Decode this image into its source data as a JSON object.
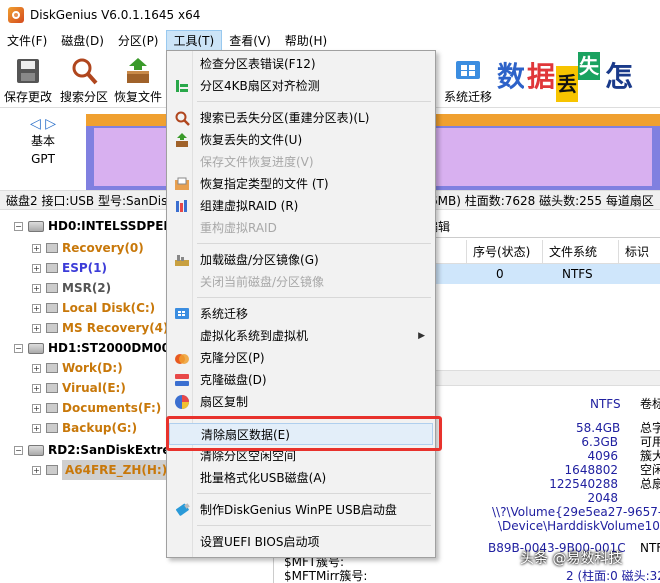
{
  "window": {
    "title": "DiskGenius V6.0.1.1645 x64"
  },
  "menubar": [
    "文件(F)",
    "磁盘(D)",
    "分区(P)",
    "工具(T)",
    "查看(V)",
    "帮助(H)"
  ],
  "toolbar": {
    "save": "保存更改",
    "search": "搜索分区",
    "recover": "恢复文件",
    "migrate": "系统迁移"
  },
  "ad": [
    "数",
    "据",
    "丢",
    "失",
    "怎"
  ],
  "nav": {
    "line1": "基本",
    "line2": "GPT"
  },
  "partition": {
    "name": "A64FRE_ZH(H:)",
    "fs": "NTFS",
    "size": "58.4GB"
  },
  "infoline": "磁盘2 接口:USB  型号:SanDisk",
  "infoline_right": "6MB)  柱面数:7628  磁头数:255  每道扇区",
  "tree": [
    {
      "label": "HD0:INTELSSDPEKK",
      "kind": "disk"
    },
    {
      "label": "Recovery(0)",
      "kind": "part",
      "color": "orange"
    },
    {
      "label": "ESP(1)",
      "kind": "part",
      "color": "blue"
    },
    {
      "label": "MSR(2)",
      "kind": "part",
      "color": "gray"
    },
    {
      "label": "Local Disk(C:)",
      "kind": "part",
      "color": "orange"
    },
    {
      "label": "MS Recovery(4)",
      "kind": "part",
      "color": "orange"
    },
    {
      "label": "HD1:ST2000DM008",
      "kind": "disk"
    },
    {
      "label": "Work(D:)",
      "kind": "part",
      "color": "orange"
    },
    {
      "label": "Virual(E:)",
      "kind": "part",
      "color": "orange"
    },
    {
      "label": "Documents(F:)",
      "kind": "part",
      "color": "orange"
    },
    {
      "label": "Backup(G:)",
      "kind": "part",
      "color": "orange"
    },
    {
      "label": "RD2:SanDiskExtrem",
      "kind": "disk"
    },
    {
      "label": "A64FRE_ZH(H:)",
      "kind": "part",
      "color": "orange",
      "selected": true
    }
  ],
  "right": {
    "tab": "编辑",
    "columns": [
      "序号(状态)",
      "文件系统",
      "标识"
    ],
    "row": {
      "index": "0",
      "fs": "NTFS"
    },
    "details_top": {
      "fs": "NTFS",
      "cut": "卷标"
    },
    "details": [
      {
        "value": "58.4GB",
        "label": "总字"
      },
      {
        "value": "6.3GB",
        "label": "可用"
      },
      {
        "value": "4096",
        "label": "簇大"
      },
      {
        "value": "1648802",
        "label": "空闲"
      },
      {
        "value": "122540288",
        "label": "总扇"
      },
      {
        "value": "2048",
        "label": ""
      }
    ],
    "volume": "\\\\?\\Volume{29e5ea27-9657-1",
    "device": "\\Device\\HarddiskVolume10",
    "serial": "B89B-0043-9B00-001C",
    "serial_label": "NTF",
    "mft_label": "$MFT簇号:",
    "mftmirr_label": "$MFTMirr簇号:",
    "mftmirr_value": "2 (柱面:0 磁头:32 扇"
  },
  "dropdown": [
    {
      "label": "检查分区表错误(F12)",
      "disabled": false
    },
    {
      "label": "分区4KB扇区对齐检测",
      "disabled": false
    },
    {
      "label": "搜索已丢失分区(重建分区表)(L)",
      "disabled": false
    },
    {
      "label": "恢复丢失的文件(U)",
      "disabled": false
    },
    {
      "label": "保存文件恢复进度(V)",
      "disabled": true
    },
    {
      "label": "恢复指定类型的文件 (T)",
      "disabled": false
    },
    {
      "label": "组建虚拟RAID (R)",
      "disabled": false
    },
    {
      "label": "重构虚拟RAID",
      "disabled": true
    },
    {
      "label": "加载磁盘/分区镜像(G)",
      "disabled": false
    },
    {
      "label": "关闭当前磁盘/分区镜像",
      "disabled": true
    },
    {
      "label": "系统迁移",
      "disabled": false
    },
    {
      "label": "虚拟化系统到虚拟机",
      "disabled": false
    },
    {
      "label": "克隆分区(P)",
      "disabled": false
    },
    {
      "label": "克隆磁盘(D)",
      "disabled": false
    },
    {
      "label": "扇区复制",
      "disabled": false
    },
    {
      "label": "清除扇区数据(E)",
      "disabled": false
    },
    {
      "label": "清除分区空闲空间",
      "disabled": false
    },
    {
      "label": "批量格式化USB磁盘(A)",
      "disabled": false
    },
    {
      "label": "制作DiskGenius WinPE USB启动盘",
      "disabled": false
    },
    {
      "label": "设置UEFI BIOS启动项",
      "disabled": false
    }
  ],
  "watermark": "头条 @易数科技",
  "colors": {
    "highlight_box": "#e8322c",
    "partition_body": "#8080e0",
    "partition_top": "#f0a030"
  }
}
